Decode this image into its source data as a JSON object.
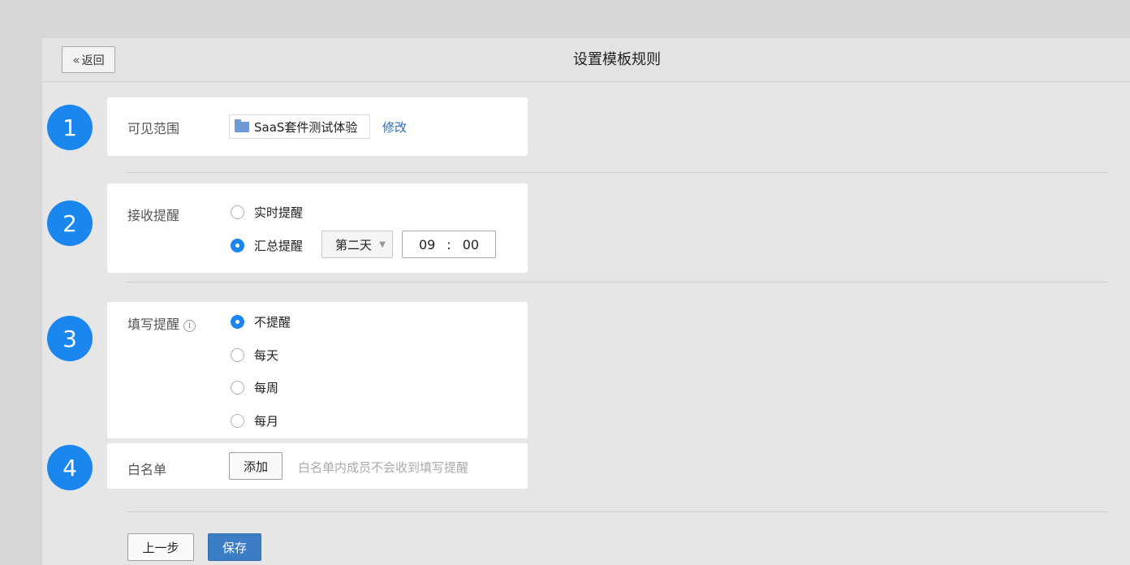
{
  "header": {
    "back_label": "返回",
    "back_icon": "double-chevron-left-icon",
    "title": "设置模板规则"
  },
  "steps": [
    "1",
    "2",
    "3",
    "4"
  ],
  "scope": {
    "label": "可见范围",
    "value": "SaaS套件测试体验",
    "icon": "folder-icon",
    "edit_label": "修改"
  },
  "receive_reminder": {
    "label": "接收提醒",
    "options": [
      {
        "label": "实时提醒",
        "checked": false
      },
      {
        "label": "汇总提醒",
        "checked": true
      }
    ],
    "day_select": "第二天",
    "time": {
      "hour": "09",
      "sep": ":",
      "minute": "00"
    }
  },
  "fill_reminder": {
    "label": "填写提醒",
    "info_icon": "i",
    "options": [
      {
        "label": "不提醒",
        "checked": true
      },
      {
        "label": "每天",
        "checked": false
      },
      {
        "label": "每周",
        "checked": false
      },
      {
        "label": "每月",
        "checked": false
      }
    ]
  },
  "whitelist": {
    "label": "白名单",
    "add_label": "添加",
    "hint": "白名单内成员不会收到填写提醒"
  },
  "footer": {
    "prev_label": "上一步",
    "save_label": "保存"
  },
  "colors": {
    "accent": "#1a86ee",
    "link": "#2a6db5",
    "save_button": "#3b7ec6"
  }
}
